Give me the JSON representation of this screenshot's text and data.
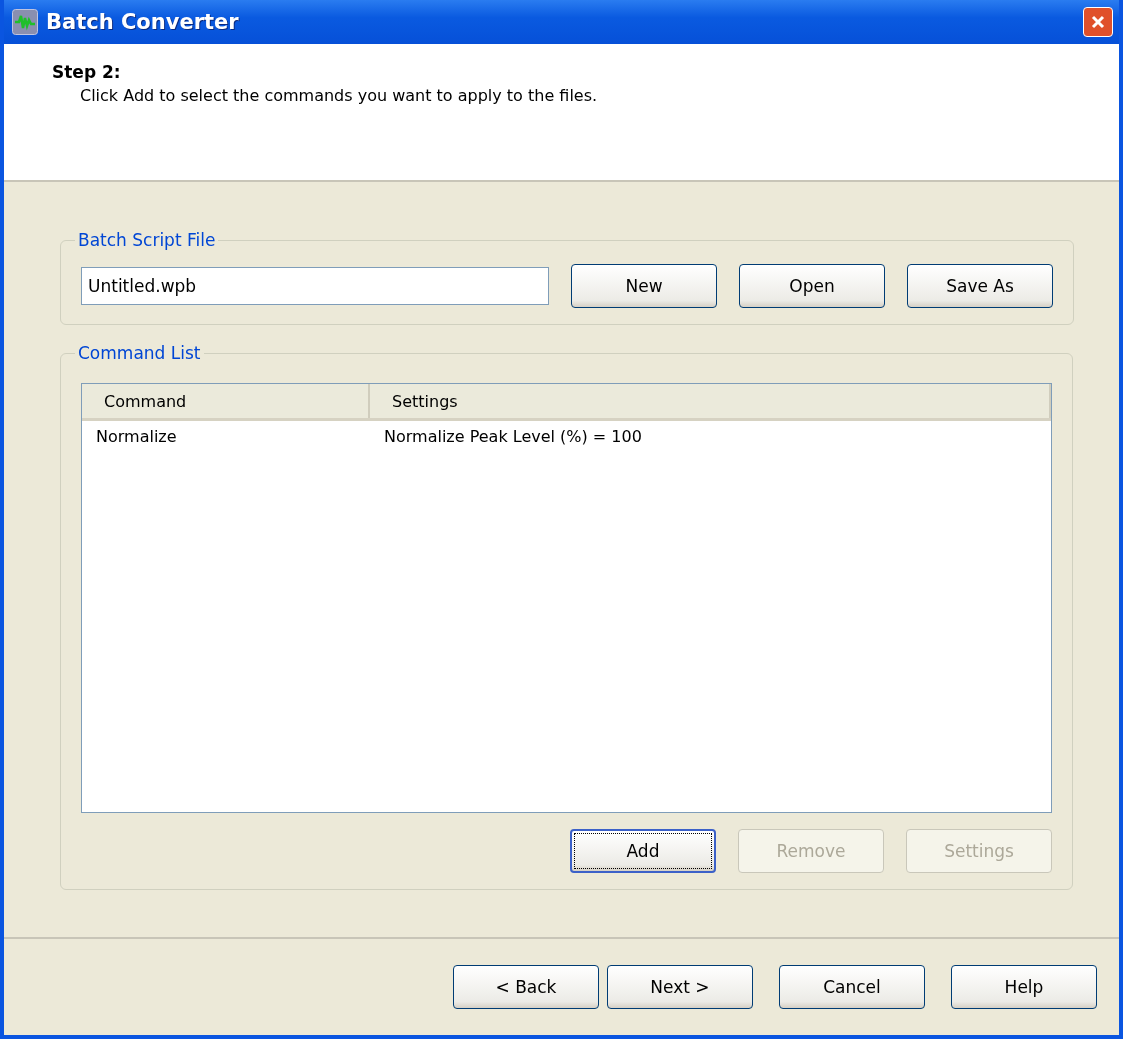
{
  "window": {
    "title": "Batch Converter"
  },
  "header": {
    "title": "Step 2:",
    "instruction": "Click Add to select the commands you want to apply to the files."
  },
  "script_group": {
    "title": "Batch Script File",
    "file_field": {
      "value": "Untitled.wpb"
    },
    "buttons": [
      {
        "label": "New",
        "disabled": false,
        "focused": false
      },
      {
        "label": "Open",
        "disabled": false,
        "focused": false
      },
      {
        "label": "Save As",
        "disabled": false,
        "focused": false
      }
    ]
  },
  "command_group": {
    "title": "Command List",
    "table": {
      "columns": [
        "Command",
        "Settings"
      ],
      "rows": [
        {
          "cells": [
            "Normalize",
            "Normalize Peak Level (%) = 100"
          ],
          "selected": false
        }
      ]
    },
    "buttons": [
      {
        "label": "Add",
        "disabled": false,
        "focused": true
      },
      {
        "label": "Remove",
        "disabled": true,
        "focused": false
      },
      {
        "label": "Settings",
        "disabled": true,
        "focused": false
      }
    ]
  },
  "footer_buttons": [
    {
      "label": "< Back",
      "disabled": false,
      "focused": false
    },
    {
      "label": "Next >",
      "disabled": false,
      "focused": false
    },
    {
      "label": "Cancel",
      "disabled": false,
      "focused": false
    },
    {
      "label": "Help",
      "disabled": false,
      "focused": false
    }
  ]
}
